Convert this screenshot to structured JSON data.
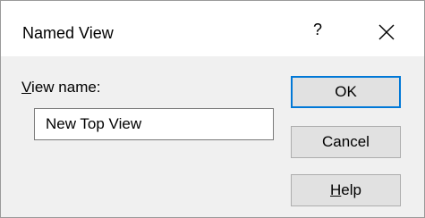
{
  "dialog": {
    "title": "Named View",
    "help_glyph": "?",
    "close_icon": "close-icon"
  },
  "form": {
    "view_name_label": "View name:",
    "view_name_value": "New Top View"
  },
  "buttons": {
    "ok_label": "OK",
    "cancel_label": "Cancel",
    "help_label": "Help"
  },
  "colors": {
    "dialog_background": "#f0f0f0",
    "titlebar_background": "#ffffff",
    "default_button_border": "#0078d7",
    "button_background": "#e1e1e1"
  }
}
